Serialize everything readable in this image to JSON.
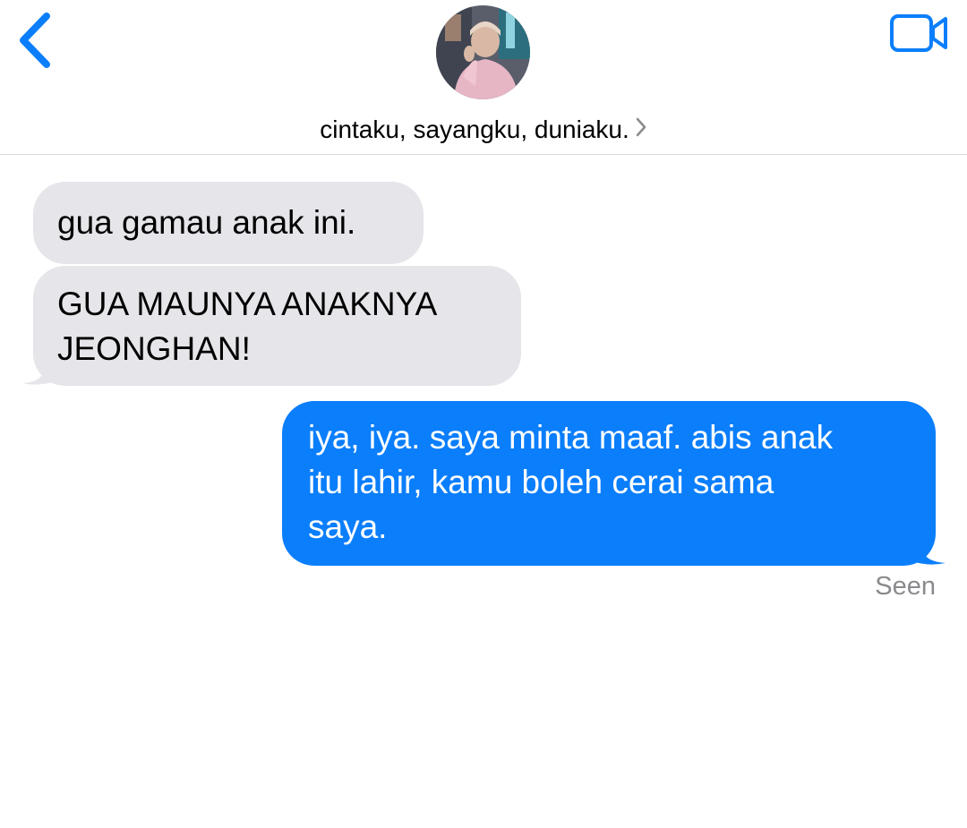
{
  "header": {
    "back_icon": "chevron-left-icon",
    "video_icon": "video-camera-icon",
    "contact_name": "cintaku, sayangku, duniaku.",
    "chevron_icon": "chevron-right-icon",
    "accent_color": "#0b7efb"
  },
  "messages": [
    {
      "direction": "incoming",
      "line1": "gua gamau anak ini."
    },
    {
      "direction": "incoming",
      "line1": "GUA MAUNYA ANAKNYA",
      "line2": "JEONGHAN!"
    },
    {
      "direction": "outgoing",
      "line1": "iya, iya. saya minta maaf. abis anak",
      "line2": "itu lahir, kamu boleh cerai sama",
      "line3": "saya."
    }
  ],
  "status": {
    "seen_label": "Seen"
  },
  "colors": {
    "incoming_bubble": "#e5e5ea",
    "outgoing_bubble": "#0b7efb",
    "status_text": "#8a8a8e"
  }
}
